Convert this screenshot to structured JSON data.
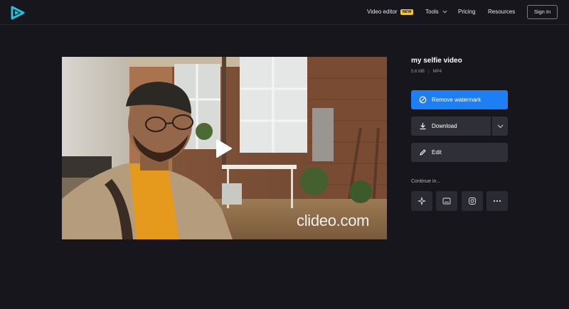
{
  "header": {
    "nav": {
      "video_editor": "Video editor",
      "new_badge": "NEW",
      "tools": "Tools",
      "pricing": "Pricing",
      "resources": "Resources"
    },
    "sign_in": "Sign In"
  },
  "video": {
    "watermark": "clideo.com"
  },
  "file": {
    "title": "my selfie video",
    "size": "5.6 MB",
    "format": "MP4"
  },
  "actions": {
    "remove_watermark": "Remove watermark",
    "download": "Download",
    "edit": "Edit"
  },
  "continue": {
    "label": "Continue in...",
    "icons": [
      "sparkle-icon",
      "subtitles-icon",
      "instagram-icon",
      "more-icon"
    ]
  },
  "colors": {
    "background": "#16161c",
    "accent": "#1e7ff5",
    "badge": "#f7c82f",
    "button_dark": "#2f2f37"
  }
}
